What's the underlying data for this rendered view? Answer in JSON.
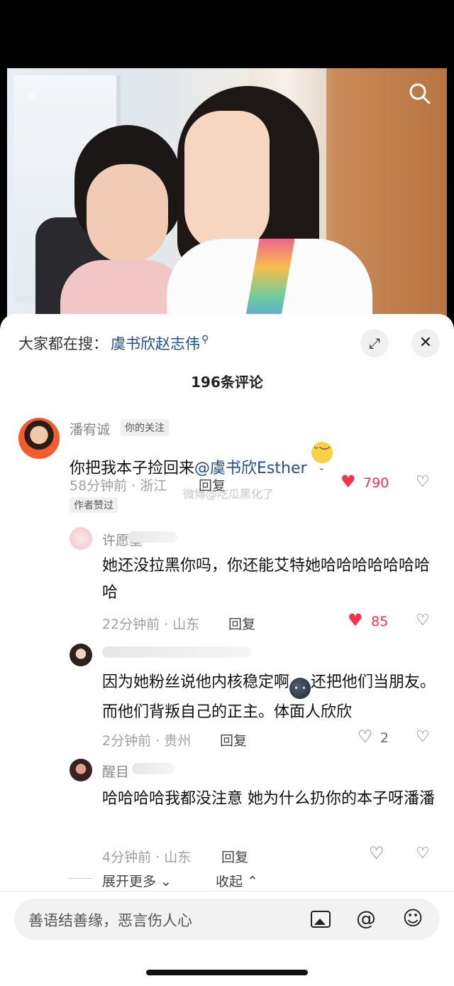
{
  "nav": {
    "back_icon": "chevron-left-icon",
    "search_icon": "search-icon"
  },
  "hot_search": {
    "prefix": "大家都在搜：",
    "term": "虞书欣赵志伟",
    "icon": "search-icon"
  },
  "sheet_buttons": {
    "expand_icon": "expand-icon",
    "close_icon": "close-icon"
  },
  "comment_count": "196条评论",
  "main_comment": {
    "username": "潘宥诚",
    "follow_tag": "你的关注",
    "text": "你把我本子捡回来",
    "mention": "@虞书欣Esther",
    "time_location": "58分钟前 · 浙江",
    "reply": "回复",
    "likes": "790",
    "author_tag": "作者赞过"
  },
  "watermark": "微博@吃瓜黑化了",
  "replies": [
    {
      "username": "许愿星",
      "text": "她还没拉黑你吗，你还能艾特她哈哈哈哈哈哈哈哈",
      "time_location": "22分钟前 · 山东",
      "reply": "回复",
      "likes": "85"
    },
    {
      "username": "",
      "text": "因为她粉丝说他内核稳定啊",
      "text_after": "还把他们当朋友。而他们背叛自己的正主。体面人欣欣",
      "time_location": "2分钟前 · 贵州",
      "reply": "回复",
      "likes": "2"
    },
    {
      "username": "醒目",
      "text": "哈哈哈哈我都没注意 她为什么扔你的本子呀潘潘",
      "time_location": "4分钟前 · 山东",
      "reply": "回复",
      "likes": ""
    }
  ],
  "expand_more": "展开更多 ⌄",
  "collapse": "收起 ⌃",
  "input": {
    "placeholder": "善语结善缘，恶言伤人心"
  },
  "colors": {
    "accent_blue": "#20508a",
    "like_red": "#f2344d",
    "sheet_bg": "#ffffff"
  }
}
